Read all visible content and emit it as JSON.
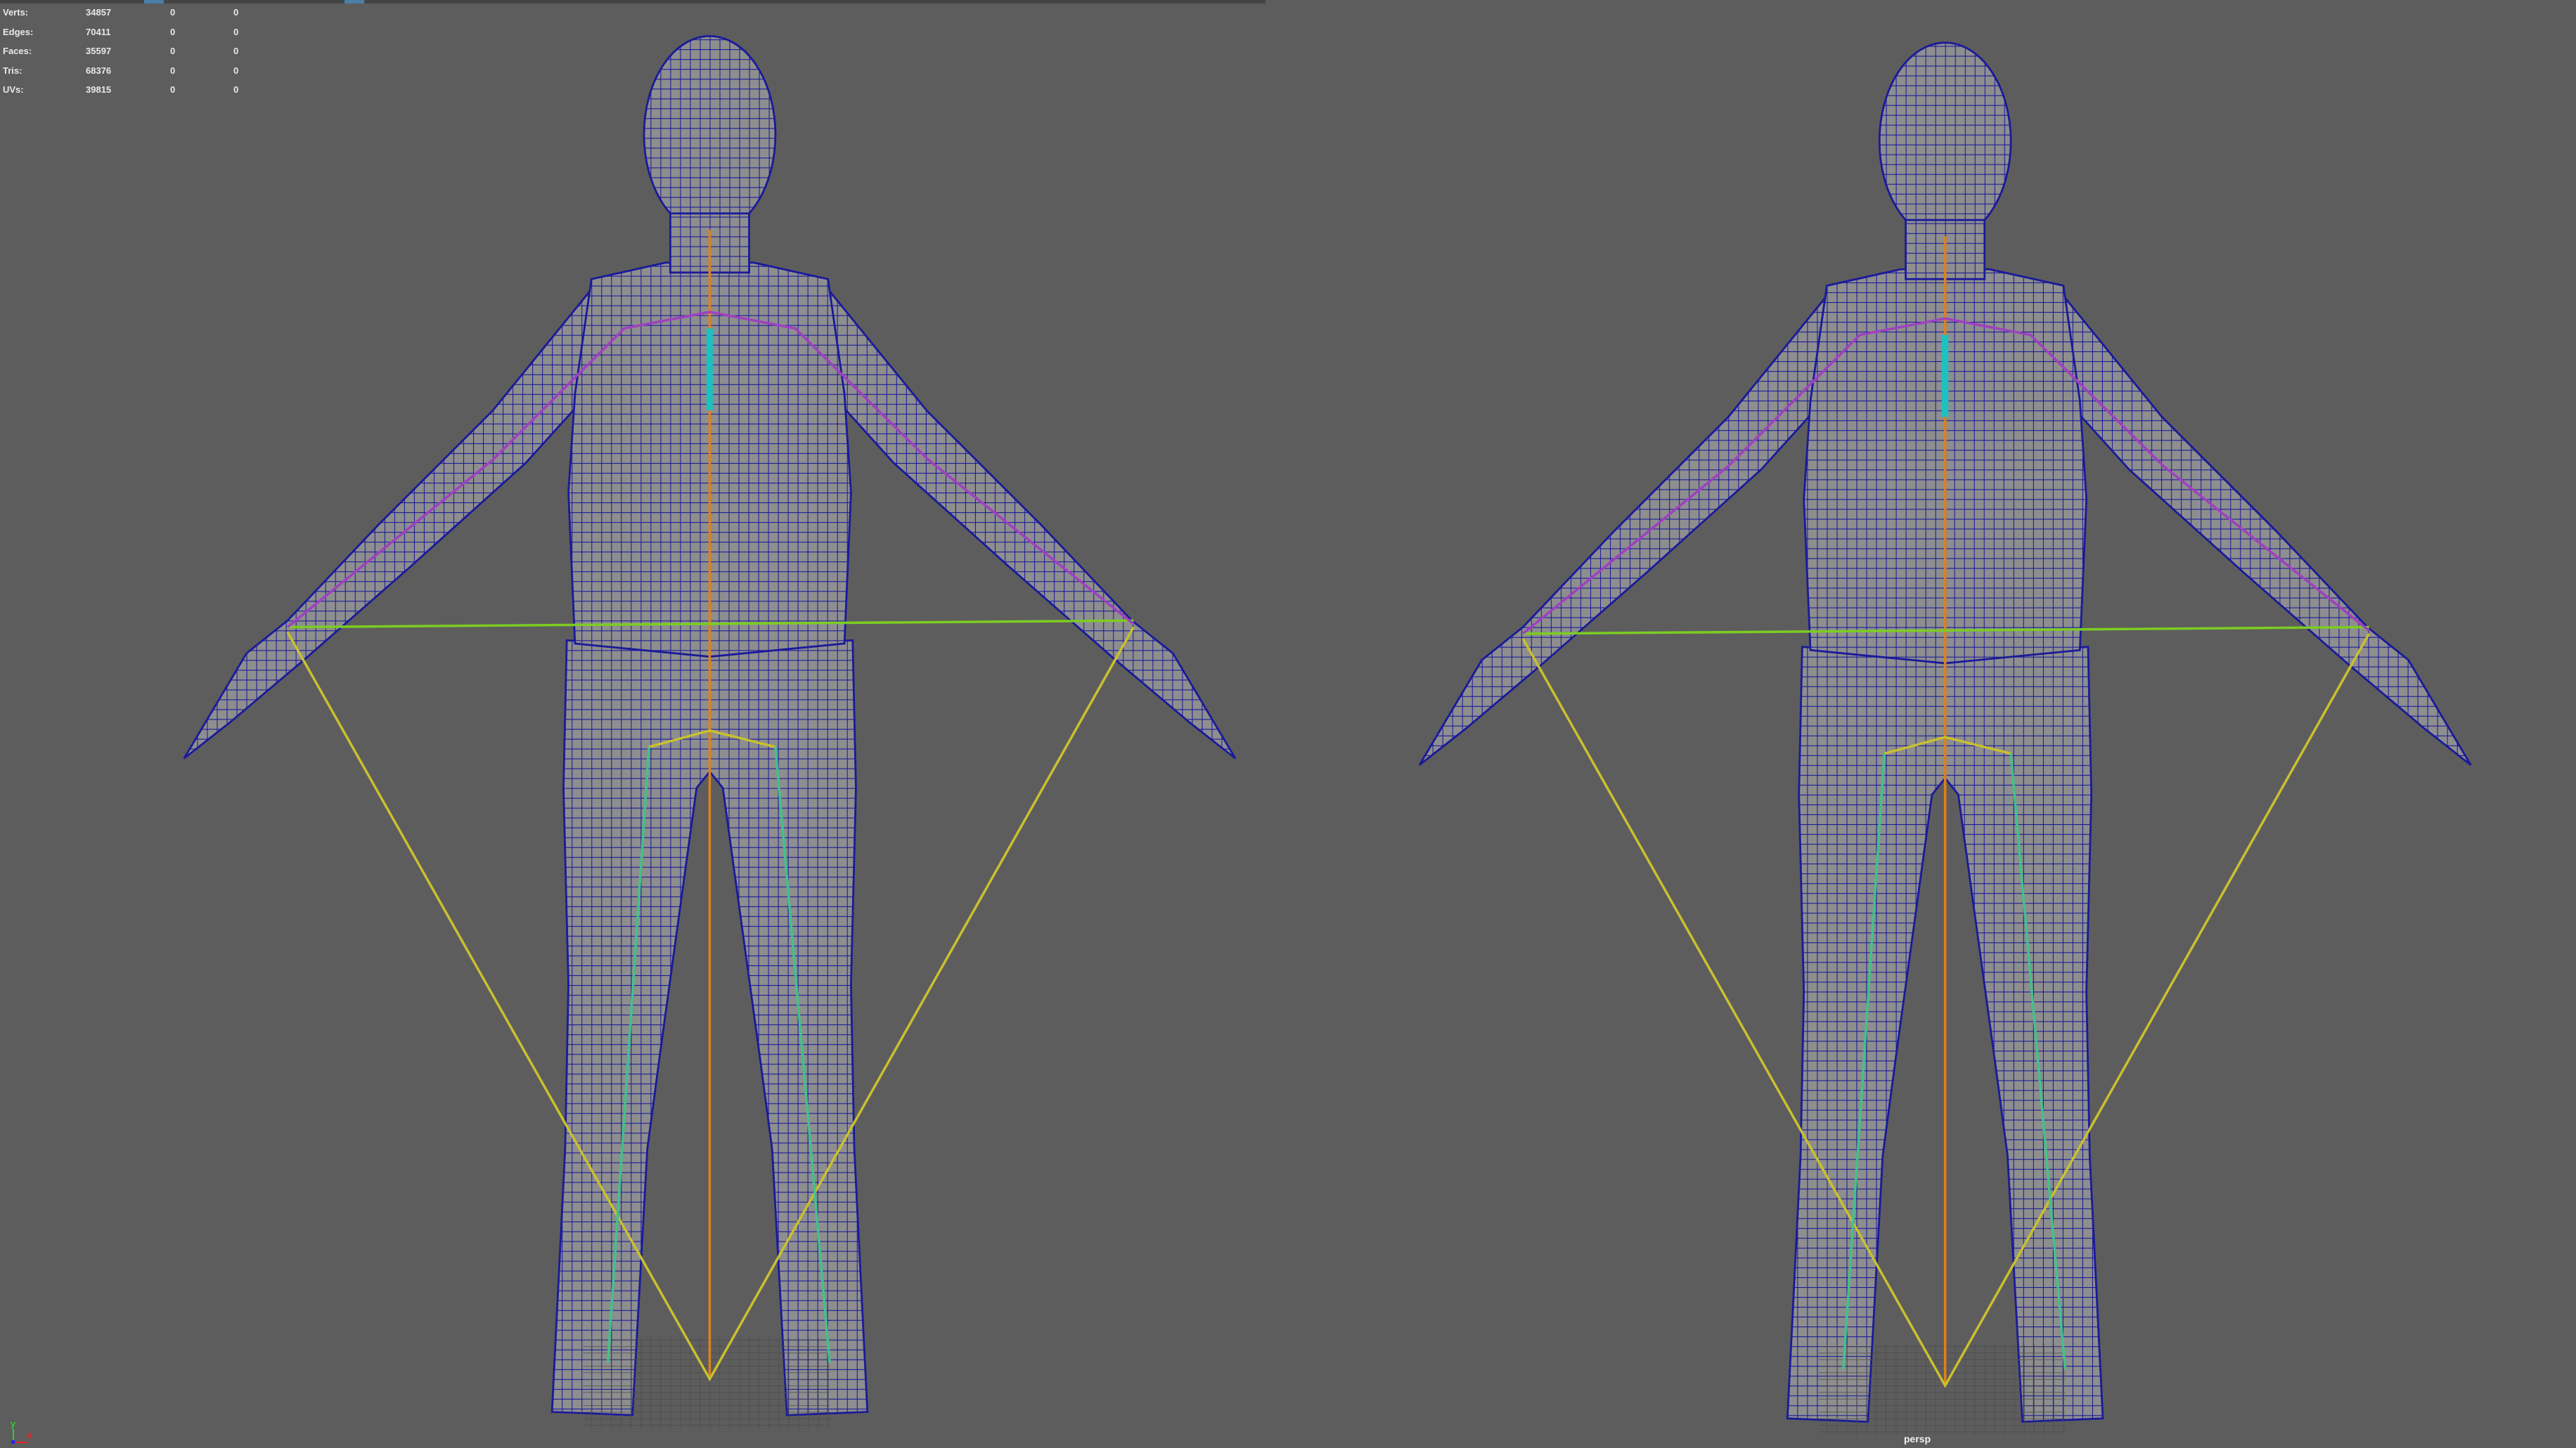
{
  "hud": {
    "rows": [
      {
        "label": "Verts:",
        "value": "34857",
        "sel": "0",
        "extra": "0"
      },
      {
        "label": "Edges:",
        "value": "70411",
        "sel": "0",
        "extra": "0"
      },
      {
        "label": "Faces:",
        "value": "35597",
        "sel": "0",
        "extra": "0"
      },
      {
        "label": "Tris:",
        "value": "68376",
        "sel": "0",
        "extra": "0"
      },
      {
        "label": "UVs:",
        "value": "39815",
        "sel": "0",
        "extra": "0"
      }
    ]
  },
  "viewport": {
    "camera_label": "persp",
    "axis_x": "x",
    "axis_y": "y",
    "colors": {
      "background": "#5d5d5d",
      "wireframe": "#1a1a9a",
      "mesh": "#8c8c8c",
      "spine": "#e0801a",
      "ik": "#c8c030",
      "hips": "#7ccc22"
    }
  }
}
